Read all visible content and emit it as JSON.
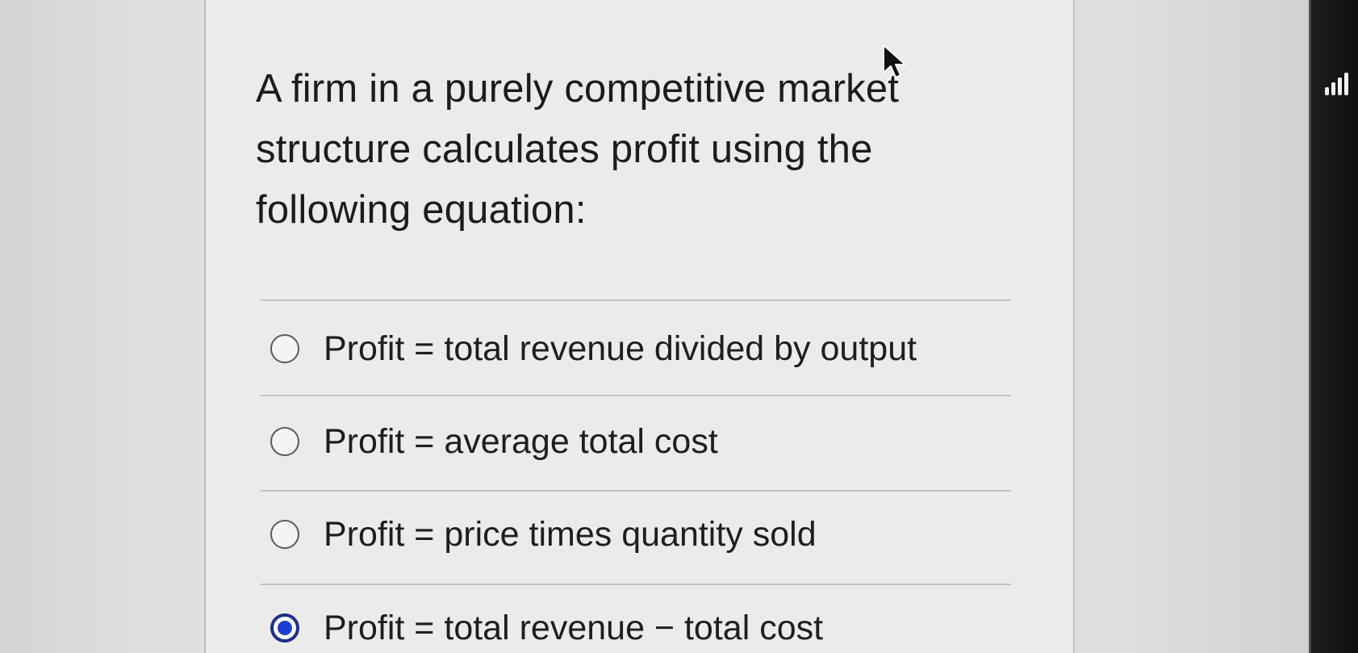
{
  "question": {
    "line1": "A firm in a purely competitive market",
    "line2": "structure calculates profit using the",
    "line3": "following equation:"
  },
  "options": [
    {
      "label": "Profit = total revenue divided by output",
      "selected": false
    },
    {
      "label": "Profit = average total cost",
      "selected": false
    },
    {
      "label": "Profit = price times quantity sold",
      "selected": false
    },
    {
      "label": "Profit = total revenue − total cost",
      "selected": true
    }
  ],
  "colors": {
    "selected_radio": "#1a3fd1",
    "panel_background": "#ebebea",
    "text": "#1e1e1e"
  },
  "icons": {
    "cursor": "mouse-pointer-icon",
    "signal": "signal-bars-icon"
  }
}
